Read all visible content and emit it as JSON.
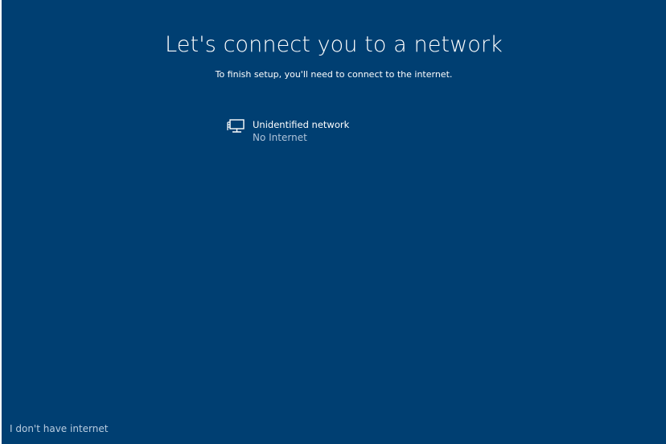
{
  "setup": {
    "title": "Let's connect you to a network",
    "subtitle": "To finish setup, you'll need to connect to the internet."
  },
  "networks": [
    {
      "icon": "wired-network-icon",
      "name": "Unidentified network",
      "status": "No Internet"
    }
  ],
  "footer": {
    "no_internet_label": "I don't have internet"
  },
  "colors": {
    "background": "#003f72",
    "text": "#ffffff",
    "muted_text": "#aec3d9"
  }
}
